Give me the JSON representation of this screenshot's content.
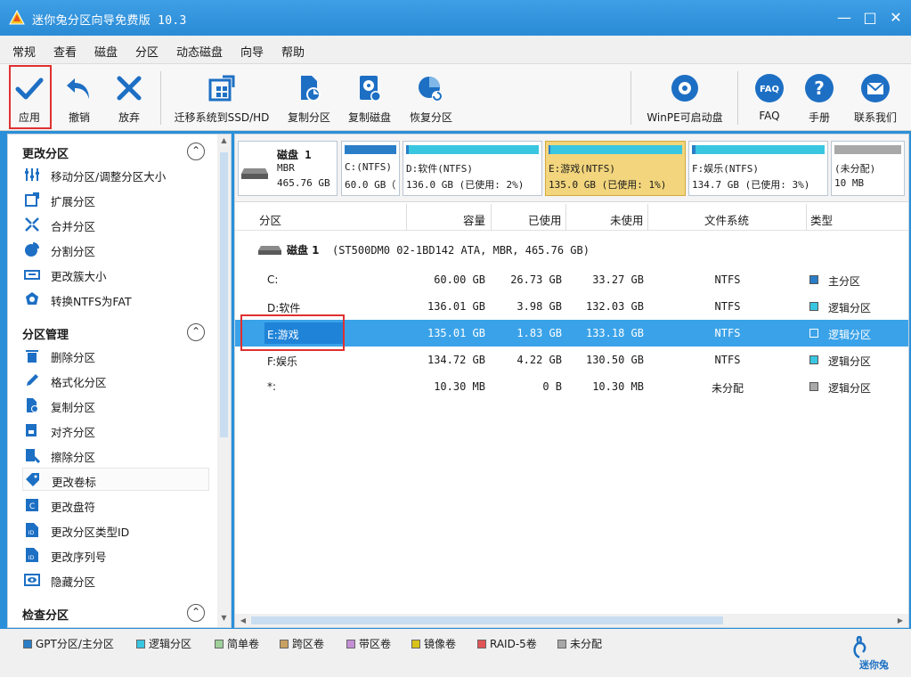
{
  "window": {
    "title": "迷你兔分区向导免费版 10.3",
    "minimize": "—",
    "maximize": "□",
    "close": "✕"
  },
  "menu": [
    "常规",
    "查看",
    "磁盘",
    "分区",
    "动态磁盘",
    "向导",
    "帮助"
  ],
  "toolbar": {
    "apply": "应用",
    "undo": "撤销",
    "discard": "放弃",
    "migrate": "迁移系统到SSD/HD",
    "copy_partition": "复制分区",
    "copy_disk": "复制磁盘",
    "recover": "恢复分区",
    "winpe": "WinPE可启动盘",
    "faq": "FAQ",
    "manual": "手册",
    "contact": "联系我们",
    "faq_badge": "FAQ",
    "help_badge": "?"
  },
  "sidebar": {
    "sections": [
      {
        "title": "更改分区",
        "items": [
          "移动分区/调整分区大小",
          "扩展分区",
          "合并分区",
          "分割分区",
          "更改簇大小",
          "转换NTFS为FAT"
        ]
      },
      {
        "title": "分区管理",
        "items": [
          "删除分区",
          "格式化分区",
          "复制分区",
          "对齐分区",
          "擦除分区",
          "更改卷标",
          "更改盘符",
          "更改分区类型ID",
          "更改序列号",
          "隐藏分区"
        ]
      },
      {
        "title": "检查分区",
        "items": []
      }
    ]
  },
  "diskmap": {
    "disk": {
      "name": "磁盘 1",
      "type": "MBR",
      "size": "465.76 GB"
    },
    "partitions": [
      {
        "l1": "C:(NTFS)",
        "l2": "60.0 GB（",
        "used": 0.45,
        "color": "#2a7ec8"
      },
      {
        "l1": "D:软件(NTFS)",
        "l2": "136.0 GB (已使用: 2%)",
        "used": 0.02,
        "color": "#39c6e0"
      },
      {
        "l1": "E:游戏(NTFS)",
        "l2": "135.0 GB (已使用: 1%)",
        "used": 0.01,
        "color": "#39c6e0"
      },
      {
        "l1": "F:娱乐(NTFS)",
        "l2": "134.7 GB (已使用: 3%)",
        "used": 0.03,
        "color": "#39c6e0"
      },
      {
        "l1": "(未分配)",
        "l2": "10 MB",
        "used": 0,
        "color": "#a8a8a8"
      }
    ]
  },
  "table": {
    "headers": [
      "分区",
      "容量",
      "已使用",
      "未使用",
      "文件系统",
      "类型"
    ],
    "disk_label": "磁盘 1",
    "disk_info": "(ST500DM0 02-1BD142 ATA, MBR, 465.76 GB)",
    "rows": [
      {
        "name": "C:",
        "capacity": "60.00 GB",
        "used": "26.73 GB",
        "unused": "33.27 GB",
        "fs": "NTFS",
        "type": "主分区",
        "color": "#2a7ec8"
      },
      {
        "name": "D:软件",
        "capacity": "136.01 GB",
        "used": "3.98 GB",
        "unused": "132.03 GB",
        "fs": "NTFS",
        "type": "逻辑分区",
        "color": "#39c6e0"
      },
      {
        "name": "E:游戏",
        "capacity": "135.01 GB",
        "used": "1.83 GB",
        "unused": "133.18 GB",
        "fs": "NTFS",
        "type": "逻辑分区",
        "color": "#39c6e0",
        "selected": true
      },
      {
        "name": "F:娱乐",
        "capacity": "134.72 GB",
        "used": "4.22 GB",
        "unused": "130.50 GB",
        "fs": "NTFS",
        "type": "逻辑分区",
        "color": "#39c6e0"
      },
      {
        "name": "*:",
        "capacity": "10.30 MB",
        "used": "0 B",
        "unused": "10.30 MB",
        "fs": "未分配",
        "type": "逻辑分区",
        "color": "#a8a8a8"
      }
    ]
  },
  "legend": [
    {
      "label": "GPT分区/主分区",
      "color": "#2a7ec8"
    },
    {
      "label": "逻辑分区",
      "color": "#39c6e0"
    },
    {
      "label": "简单卷",
      "color": "#9fd29a"
    },
    {
      "label": "跨区卷",
      "color": "#c9a163"
    },
    {
      "label": "带区卷",
      "color": "#c58fd6"
    },
    {
      "label": "镜像卷",
      "color": "#d9c21a"
    },
    {
      "label": "RAID-5卷",
      "color": "#e25555"
    },
    {
      "label": "未分配",
      "color": "#a8a8a8"
    }
  ],
  "logo_text": "迷你兔"
}
